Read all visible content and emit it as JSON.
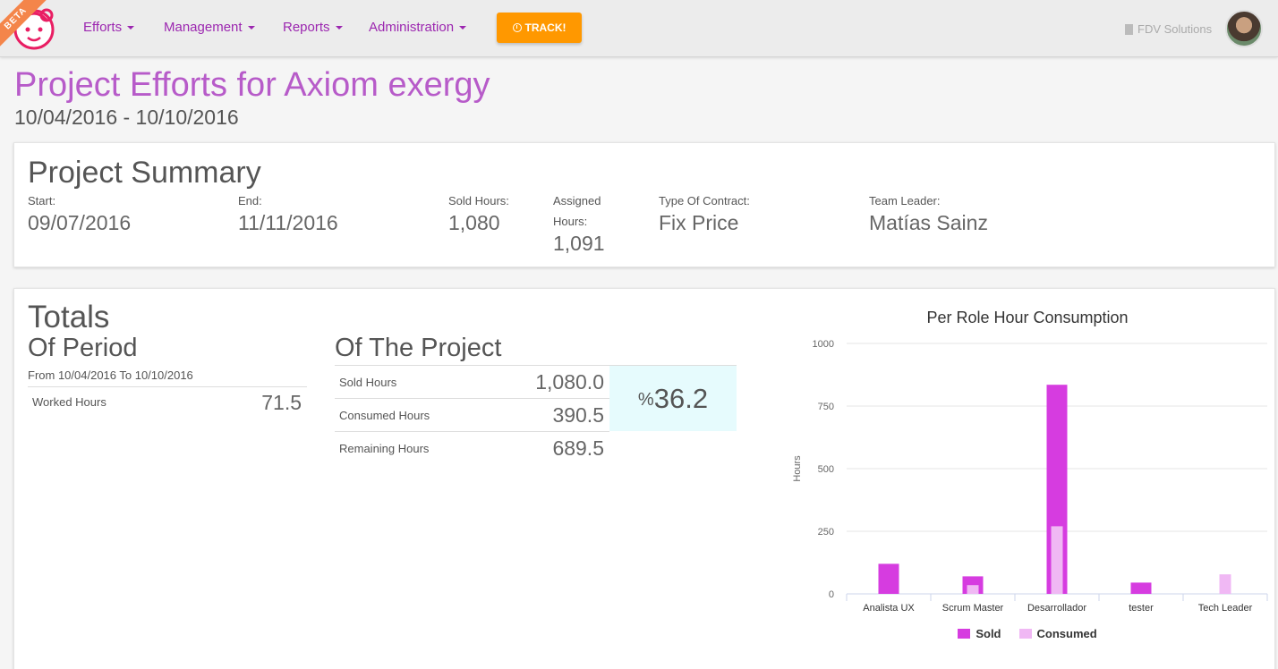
{
  "nav": {
    "beta_label": "BETA",
    "items": [
      {
        "label": "Efforts"
      },
      {
        "label": "Management"
      },
      {
        "label": "Reports"
      },
      {
        "label": "Administration"
      }
    ],
    "track_label": "TRACK!",
    "company": "FDV Solutions",
    "accent": "#9c27b0",
    "track_color": "#ff9800"
  },
  "header": {
    "title": "Project Efforts for Axiom exergy",
    "date_range": "10/04/2016 - 10/10/2016"
  },
  "summary": {
    "title": "Project Summary",
    "start_label": "Start:",
    "start_value": "09/07/2016",
    "end_label": "End:",
    "end_value": "11/11/2016",
    "sold_label": "Sold Hours:",
    "sold_value": "1,080",
    "assigned_label_1": "Assigned",
    "assigned_label_2": "Hours:",
    "assigned_value": "1,091",
    "contract_label": "Type Of Contract:",
    "contract_value": "Fix Price",
    "leader_label": "Team Leader:",
    "leader_value": "Matías Sainz"
  },
  "totals": {
    "title": "Totals",
    "period": {
      "title": "Of Period",
      "range": "From 10/04/2016 To 10/10/2016",
      "worked_label": "Worked Hours",
      "worked_value": "71.5"
    },
    "project": {
      "title": "Of The Project",
      "rows": [
        {
          "label": "Sold Hours",
          "value": "1,080.0"
        },
        {
          "label": "Consumed Hours",
          "value": "390.5"
        },
        {
          "label": "Remaining Hours",
          "value": "689.5"
        }
      ],
      "pct_sign": "%",
      "pct_value": "36.2"
    }
  },
  "chart_data": {
    "type": "bar",
    "title": "Per Role Hour Consumption",
    "xlabel": "",
    "ylabel": "Hours",
    "ylim": [
      0,
      1000
    ],
    "yticks": [
      "0",
      "250",
      "500",
      "750",
      "1000"
    ],
    "categories": [
      "Analista UX",
      "Scrum Master",
      "Desarrollador",
      "tester",
      "Tech Leader"
    ],
    "series": [
      {
        "name": "Sold",
        "color": "#d63ce0",
        "values": [
          120,
          70,
          835,
          45,
          0
        ]
      },
      {
        "name": "Consumed",
        "color": "#f0b8f4",
        "values": [
          0,
          35,
          270,
          0,
          78
        ]
      }
    ],
    "grid": true,
    "legend": "bottom"
  }
}
